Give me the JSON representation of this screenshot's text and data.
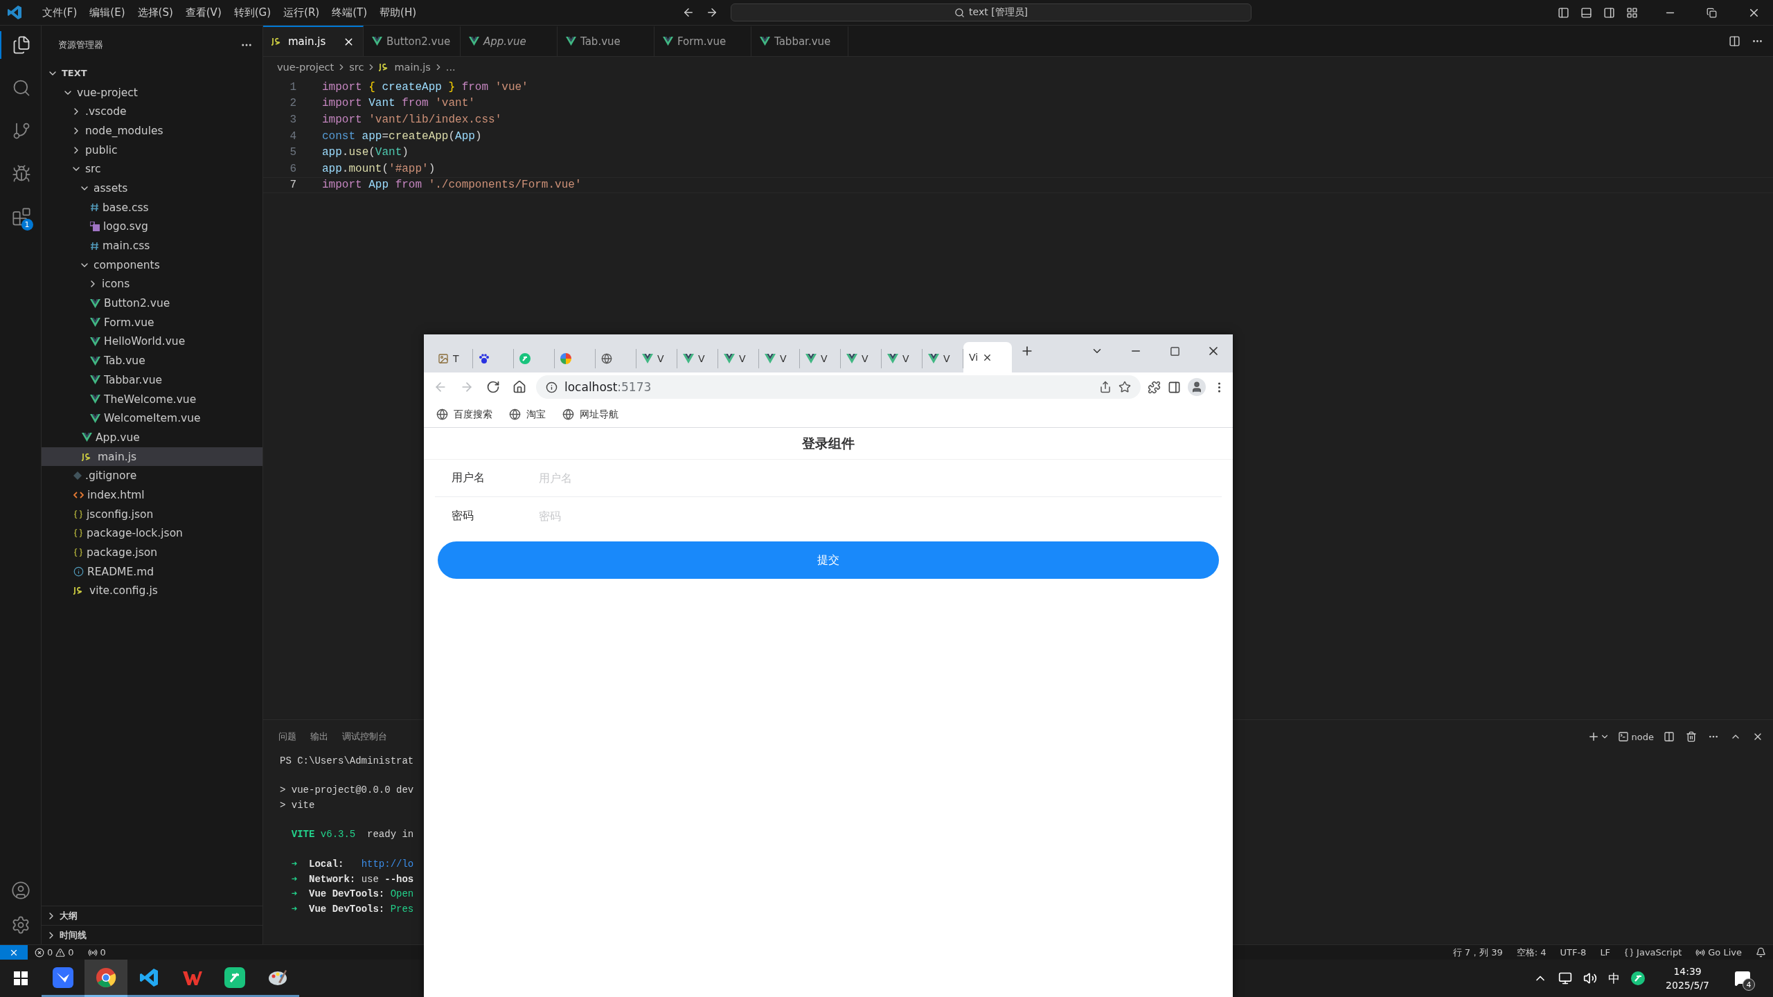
{
  "vscode": {
    "menu": [
      "文件(F)",
      "编辑(E)",
      "选择(S)",
      "查看(V)",
      "转到(G)",
      "运行(R)",
      "终端(T)",
      "帮助(H)"
    ],
    "command_center": "text [管理员]",
    "activity_bar": [
      {
        "kind": "files",
        "selected": true
      },
      {
        "kind": "search",
        "selected": false
      },
      {
        "kind": "scm",
        "selected": false
      },
      {
        "kind": "debug",
        "selected": false
      },
      {
        "kind": "extensions",
        "selected": false,
        "badge": "1"
      }
    ],
    "explorer": {
      "title": "资源管理器",
      "root": "TEXT",
      "tree": [
        {
          "name": "vue-project",
          "kind": "folder",
          "expanded": true,
          "selected": false,
          "children": [
            {
              "name": ".vscode",
              "kind": "folder",
              "expanded": false,
              "selected": false
            },
            {
              "name": "node_modules",
              "kind": "folder",
              "expanded": false,
              "selected": false
            },
            {
              "name": "public",
              "kind": "folder",
              "expanded": false,
              "selected": false
            },
            {
              "name": "src",
              "kind": "folder",
              "expanded": true,
              "selected": false,
              "children": [
                {
                  "name": "assets",
                  "kind": "folder",
                  "expanded": true,
                  "selected": false,
                  "children": [
                    {
                      "name": "base.css",
                      "kind": "css",
                      "selected": false
                    },
                    {
                      "name": "logo.svg",
                      "kind": "svg",
                      "selected": false
                    },
                    {
                      "name": "main.css",
                      "kind": "css",
                      "selected": false
                    }
                  ]
                },
                {
                  "name": "components",
                  "kind": "folder",
                  "expanded": true,
                  "selected": false,
                  "children": [
                    {
                      "name": "icons",
                      "kind": "folder",
                      "expanded": false,
                      "selected": false
                    },
                    {
                      "name": "Button2.vue",
                      "kind": "vue",
                      "selected": false
                    },
                    {
                      "name": "Form.vue",
                      "kind": "vue",
                      "selected": false
                    },
                    {
                      "name": "HelloWorld.vue",
                      "kind": "vue",
                      "selected": false
                    },
                    {
                      "name": "Tab.vue",
                      "kind": "vue",
                      "selected": false
                    },
                    {
                      "name": "Tabbar.vue",
                      "kind": "vue",
                      "selected": false
                    },
                    {
                      "name": "TheWelcome.vue",
                      "kind": "vue",
                      "selected": false
                    },
                    {
                      "name": "WelcomeItem.vue",
                      "kind": "vue",
                      "selected": false
                    }
                  ]
                },
                {
                  "name": "App.vue",
                  "kind": "vue",
                  "selected": false
                },
                {
                  "name": "main.js",
                  "kind": "js",
                  "selected": true
                }
              ]
            },
            {
              "name": ".gitignore",
              "kind": "git",
              "selected": false
            },
            {
              "name": "index.html",
              "kind": "html",
              "selected": false
            },
            {
              "name": "jsconfig.json",
              "kind": "json",
              "selected": false
            },
            {
              "name": "package-lock.json",
              "kind": "json",
              "selected": false
            },
            {
              "name": "package.json",
              "kind": "json",
              "selected": false
            },
            {
              "name": "README.md",
              "kind": "info",
              "selected": false
            },
            {
              "name": "vite.config.js",
              "kind": "js",
              "selected": false
            }
          ]
        }
      ],
      "sections": [
        {
          "label": "大纲",
          "expanded": false
        },
        {
          "label": "时间线",
          "expanded": false
        }
      ]
    },
    "editor_tabs": [
      {
        "label": "main.js",
        "kind": "js",
        "selected": true,
        "preview": false
      },
      {
        "label": "Button2.vue",
        "kind": "vue",
        "selected": false,
        "preview": false
      },
      {
        "label": "App.vue",
        "kind": "vue",
        "selected": false,
        "preview": true
      },
      {
        "label": "Tab.vue",
        "kind": "vue",
        "selected": false,
        "preview": false
      },
      {
        "label": "Form.vue",
        "kind": "vue",
        "selected": false,
        "preview": false
      },
      {
        "label": "Tabbar.vue",
        "kind": "vue",
        "selected": false,
        "preview": false
      }
    ],
    "breadcrumbs": [
      {
        "label": "vue-project",
        "kind": "text"
      },
      {
        "label": "src",
        "kind": "text"
      },
      {
        "label": "main.js",
        "kind": "js"
      },
      {
        "label": "...",
        "kind": "text"
      }
    ],
    "code": [
      {
        "number": "1",
        "current": false,
        "tokens": [
          {
            "text": "import ",
            "kind": "keyword"
          },
          {
            "text": "{",
            "kind": "brace"
          },
          {
            "text": " createApp ",
            "kind": "var"
          },
          {
            "text": "}",
            "kind": "brace"
          },
          {
            "text": " from ",
            "kind": "keyword"
          },
          {
            "text": "'vue'",
            "kind": "string"
          }
        ]
      },
      {
        "number": "2",
        "current": false,
        "tokens": [
          {
            "text": "import ",
            "kind": "keyword"
          },
          {
            "text": "Vant",
            "kind": "var"
          },
          {
            "text": " from ",
            "kind": "keyword"
          },
          {
            "text": "'vant'",
            "kind": "string"
          }
        ]
      },
      {
        "number": "3",
        "current": false,
        "tokens": [
          {
            "text": "import ",
            "kind": "keyword"
          },
          {
            "text": "'vant/lib/index.css'",
            "kind": "string"
          }
        ]
      },
      {
        "number": "4",
        "current": false,
        "tokens": [
          {
            "text": "const ",
            "kind": "storage"
          },
          {
            "text": "app",
            "kind": "var"
          },
          {
            "text": "=",
            "kind": "plain"
          },
          {
            "text": "createApp",
            "kind": "func"
          },
          {
            "text": "(",
            "kind": "plain"
          },
          {
            "text": "App",
            "kind": "var"
          },
          {
            "text": ")",
            "kind": "plain"
          }
        ]
      },
      {
        "number": "5",
        "current": false,
        "tokens": [
          {
            "text": "app",
            "kind": "var"
          },
          {
            "text": ".",
            "kind": "plain"
          },
          {
            "text": "use",
            "kind": "func"
          },
          {
            "text": "(",
            "kind": "plain"
          },
          {
            "text": "Vant",
            "kind": "class"
          },
          {
            "text": ")",
            "kind": "plain"
          }
        ]
      },
      {
        "number": "6",
        "current": false,
        "tokens": [
          {
            "text": "app",
            "kind": "var"
          },
          {
            "text": ".",
            "kind": "plain"
          },
          {
            "text": "mount",
            "kind": "func"
          },
          {
            "text": "(",
            "kind": "plain"
          },
          {
            "text": "'#app'",
            "kind": "string"
          },
          {
            "text": ")",
            "kind": "plain"
          }
        ]
      },
      {
        "number": "7",
        "current": true,
        "tokens": [
          {
            "text": "import ",
            "kind": "keyword"
          },
          {
            "text": "App",
            "kind": "var"
          },
          {
            "text": " from ",
            "kind": "keyword"
          },
          {
            "text": "'./components/Form.vue'",
            "kind": "string"
          }
        ]
      }
    ],
    "panel": {
      "tabs": [
        "问题",
        "输出",
        "调试控制台"
      ],
      "terminal_label": "node",
      "blocks": [
        [
          {
            "tokens": [
              {
                "text": "PS C:\\Users\\Administrat",
                "kind": "plain"
              }
            ]
          }
        ],
        [
          {
            "tokens": [
              {
                "text": "> vue-project@0.0.0 dev",
                "kind": "plain"
              }
            ]
          },
          {
            "tokens": [
              {
                "text": "> vite",
                "kind": "plain"
              }
            ]
          }
        ],
        [
          {
            "tokens": [
              {
                "text": "  VITE",
                "kind": "greenbold"
              },
              {
                "text": " v6.3.5",
                "kind": "green"
              },
              {
                "text": "  ready in",
                "kind": "plain"
              }
            ]
          }
        ],
        [
          {
            "tokens": [
              {
                "text": "  ➜",
                "kind": "green"
              },
              {
                "text": "  Local:",
                "kind": "bold"
              },
              {
                "text": "   http://lo",
                "kind": "link"
              }
            ]
          },
          {
            "tokens": [
              {
                "text": "  ➜",
                "kind": "green"
              },
              {
                "text": "  Network:",
                "kind": "bold"
              },
              {
                "text": " use ",
                "kind": "plain"
              },
              {
                "text": "--hos",
                "kind": "bold"
              }
            ]
          },
          {
            "tokens": [
              {
                "text": "  ➜",
                "kind": "green"
              },
              {
                "text": "  Vue DevTools:",
                "kind": "bold"
              },
              {
                "text": " Open",
                "kind": "green"
              }
            ]
          },
          {
            "tokens": [
              {
                "text": "  ➜",
                "kind": "green"
              },
              {
                "text": "  Vue DevTools:",
                "kind": "bold"
              },
              {
                "text": " Pres",
                "kind": "green"
              }
            ]
          }
        ]
      ]
    },
    "status_bar": {
      "errors": "0",
      "warnings": "0",
      "ports": "0",
      "right": [
        {
          "label": "行 7，列 39",
          "kind": "text"
        },
        {
          "label": "空格: 4",
          "kind": "text"
        },
        {
          "label": "UTF-8",
          "kind": "text"
        },
        {
          "label": "LF",
          "kind": "text"
        },
        {
          "label": "JavaScript",
          "kind": "language"
        },
        {
          "label": "Go Live",
          "kind": "golive"
        }
      ]
    }
  },
  "browser": {
    "tabs": [
      {
        "kind": "image",
        "label": "T",
        "selected": false
      },
      {
        "kind": "baidu",
        "selected": false
      },
      {
        "kind": "pp",
        "selected": false
      },
      {
        "kind": "colorful",
        "selected": false
      },
      {
        "kind": "globe",
        "selected": false
      },
      {
        "kind": "vue",
        "label": "V",
        "selected": false
      },
      {
        "kind": "vue",
        "label": "V",
        "selected": false
      },
      {
        "kind": "vue",
        "label": "V",
        "selected": false
      },
      {
        "kind": "vue",
        "label": "V",
        "selected": false
      },
      {
        "kind": "vue",
        "label": "V",
        "selected": false
      },
      {
        "kind": "vue",
        "label": "V",
        "selected": false
      },
      {
        "kind": "vue",
        "label": "V",
        "selected": false
      },
      {
        "kind": "vue",
        "label": "V",
        "selected": false
      },
      {
        "kind": "plain",
        "label": "Vi",
        "selected": true
      }
    ],
    "nav": [
      {
        "kind": "back",
        "disabled": true
      },
      {
        "kind": "forward",
        "disabled": true
      },
      {
        "kind": "reload",
        "disabled": false
      },
      {
        "kind": "home",
        "disabled": false
      }
    ],
    "address": {
      "host": "localhost",
      "port": ":5173"
    },
    "bookmarks": [
      "百度搜索",
      "淘宝",
      "网址导航"
    ],
    "page": {
      "title": "登录组件",
      "fields": [
        {
          "label": "用户名",
          "placeholder": "用户名"
        },
        {
          "label": "密码",
          "placeholder": "密码"
        }
      ],
      "submit": "提交"
    }
  },
  "taskbar": {
    "apps": [
      {
        "kind": "lark",
        "active": false
      },
      {
        "kind": "chrome",
        "active": true
      },
      {
        "kind": "vscode",
        "active": false
      },
      {
        "kind": "wps",
        "active": false
      },
      {
        "kind": "pp",
        "active": false
      },
      {
        "kind": "paint",
        "active": false
      }
    ],
    "ime": "中",
    "time": "14:39",
    "date": "2025/5/7",
    "notifications": "4"
  }
}
